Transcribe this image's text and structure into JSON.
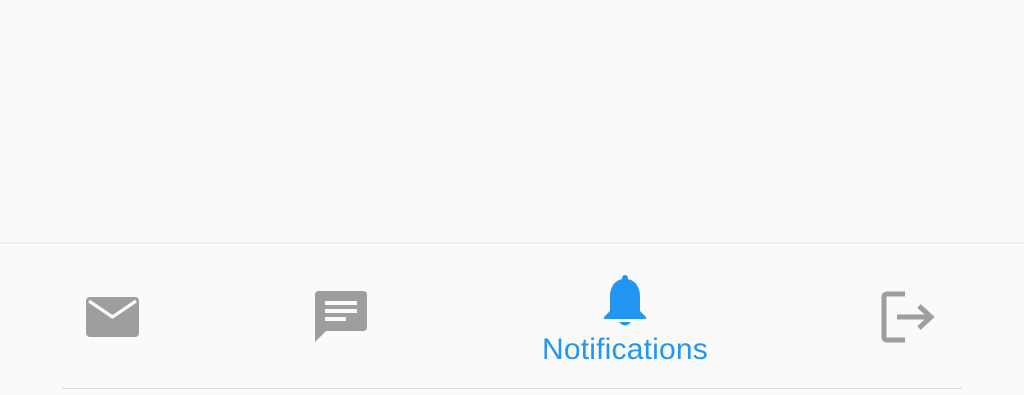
{
  "bottom_nav": {
    "items": [
      {
        "id": "mail",
        "icon": "mail-icon",
        "label": "",
        "active": false,
        "color": "#9e9e9e"
      },
      {
        "id": "messages",
        "icon": "chat-icon",
        "label": "",
        "active": false,
        "color": "#9e9e9e"
      },
      {
        "id": "notifications",
        "icon": "bell-icon",
        "label": "Notifications",
        "active": true,
        "color": "#2196f3"
      },
      {
        "id": "logout",
        "icon": "logout-icon",
        "label": "",
        "active": false,
        "color": "#9e9e9e"
      }
    ]
  },
  "colors": {
    "background": "#fafafa",
    "active": "#2196f3",
    "inactive": "#9e9e9e"
  }
}
